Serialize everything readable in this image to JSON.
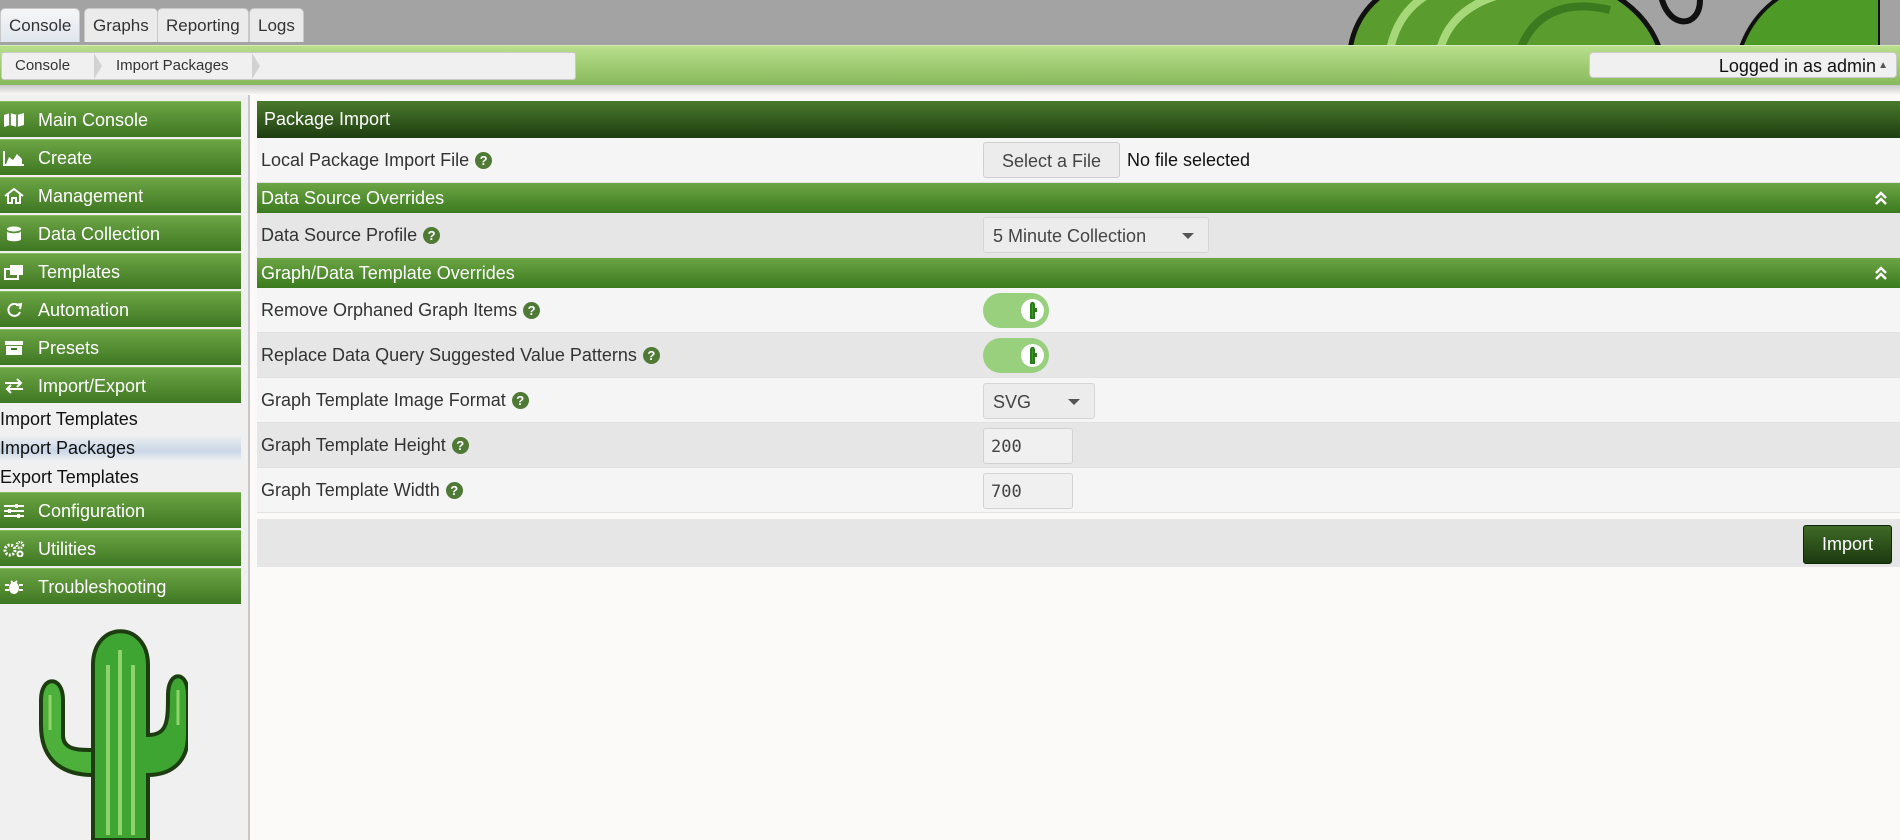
{
  "tabs": [
    {
      "label": "Console"
    },
    {
      "label": "Graphs"
    },
    {
      "label": "Reporting"
    },
    {
      "label": "Logs"
    }
  ],
  "breadcrumb": [
    "Console",
    "Import Packages"
  ],
  "user": {
    "label": "Logged in as admin"
  },
  "sidebar": {
    "items": [
      {
        "label": "Main Console",
        "icon": "map-icon"
      },
      {
        "label": "Create",
        "icon": "area-chart-icon"
      },
      {
        "label": "Management",
        "icon": "home-icon"
      },
      {
        "label": "Data Collection",
        "icon": "database-icon"
      },
      {
        "label": "Templates",
        "icon": "clone-icon"
      },
      {
        "label": "Automation",
        "icon": "refresh-icon"
      },
      {
        "label": "Presets",
        "icon": "archive-icon"
      },
      {
        "label": "Import/Export",
        "icon": "exchange-icon"
      }
    ],
    "subitems": [
      "Import Templates",
      "Import Packages",
      "Export Templates"
    ],
    "items_after": [
      {
        "label": "Configuration",
        "icon": "sliders-icon"
      },
      {
        "label": "Utilities",
        "icon": "cogs-icon"
      },
      {
        "label": "Troubleshooting",
        "icon": "bug-icon"
      }
    ]
  },
  "main": {
    "title": "Package Import",
    "file_row": {
      "label": "Local Package Import File",
      "button": "Select a File",
      "status": "No file selected"
    },
    "ds_section": "Data Source Overrides",
    "ds_profile": {
      "label": "Data Source Profile",
      "value": "5 Minute Collection"
    },
    "gt_section": "Graph/Data Template Overrides",
    "remove_orphaned": {
      "label": "Remove Orphaned Graph Items",
      "on": true
    },
    "replace_patterns": {
      "label": "Replace Data Query Suggested Value Patterns",
      "on": true
    },
    "image_format": {
      "label": "Graph Template Image Format",
      "value": "SVG"
    },
    "height": {
      "label": "Graph Template Height",
      "value": "200"
    },
    "width": {
      "label": "Graph Template Width",
      "value": "700"
    },
    "import_button": "Import"
  },
  "colors": {
    "accent_green": "#3e7722",
    "header_dark": "#1e3d11",
    "toggle_on": "#98d07d"
  }
}
